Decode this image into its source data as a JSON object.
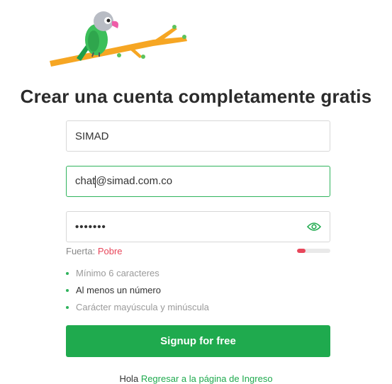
{
  "brand": {
    "logo_icon": "parrot-on-branch-icon",
    "colors": {
      "accent": "#1faa4e",
      "weak": "#e8465a"
    }
  },
  "heading": "Crear una cuenta completamente gratis",
  "form": {
    "name_value": "SIMAD",
    "email_before_caret": "chat",
    "email_after_caret": "@simad.com.co",
    "password_masked": "•••••••",
    "password_toggle_icon": "eye-icon",
    "strength_label": "Fuerta:",
    "strength_value": "Pobre",
    "strength_level": 0.25
  },
  "requirements": [
    {
      "text": "Mínimo 6 caracteres",
      "met": false
    },
    {
      "text": "Al menos un número",
      "met": true
    },
    {
      "text": "Carácter mayúscula y minúscula",
      "met": false
    }
  ],
  "submit_label": "Signup for free",
  "footer": {
    "prefix": "Hola",
    "link": "Regresar a la página de Ingreso"
  }
}
